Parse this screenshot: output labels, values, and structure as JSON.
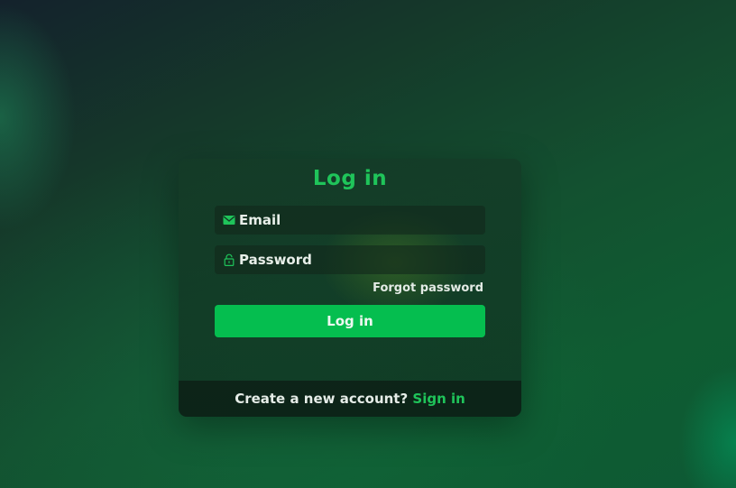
{
  "login_card": {
    "title": "Log in",
    "email": {
      "placeholder": "Email",
      "value": "",
      "icon": "mail-icon"
    },
    "password": {
      "placeholder": "Password",
      "value": "",
      "icon": "lock-icon"
    },
    "forgot_password_label": "Forgot password",
    "submit_label": "Log in",
    "footer": {
      "prompt": "Create a new account?",
      "link_label": "Sign in"
    }
  },
  "colors": {
    "accent": "#1fc45a",
    "button": "#05be4f",
    "text": "#e8efe9"
  }
}
